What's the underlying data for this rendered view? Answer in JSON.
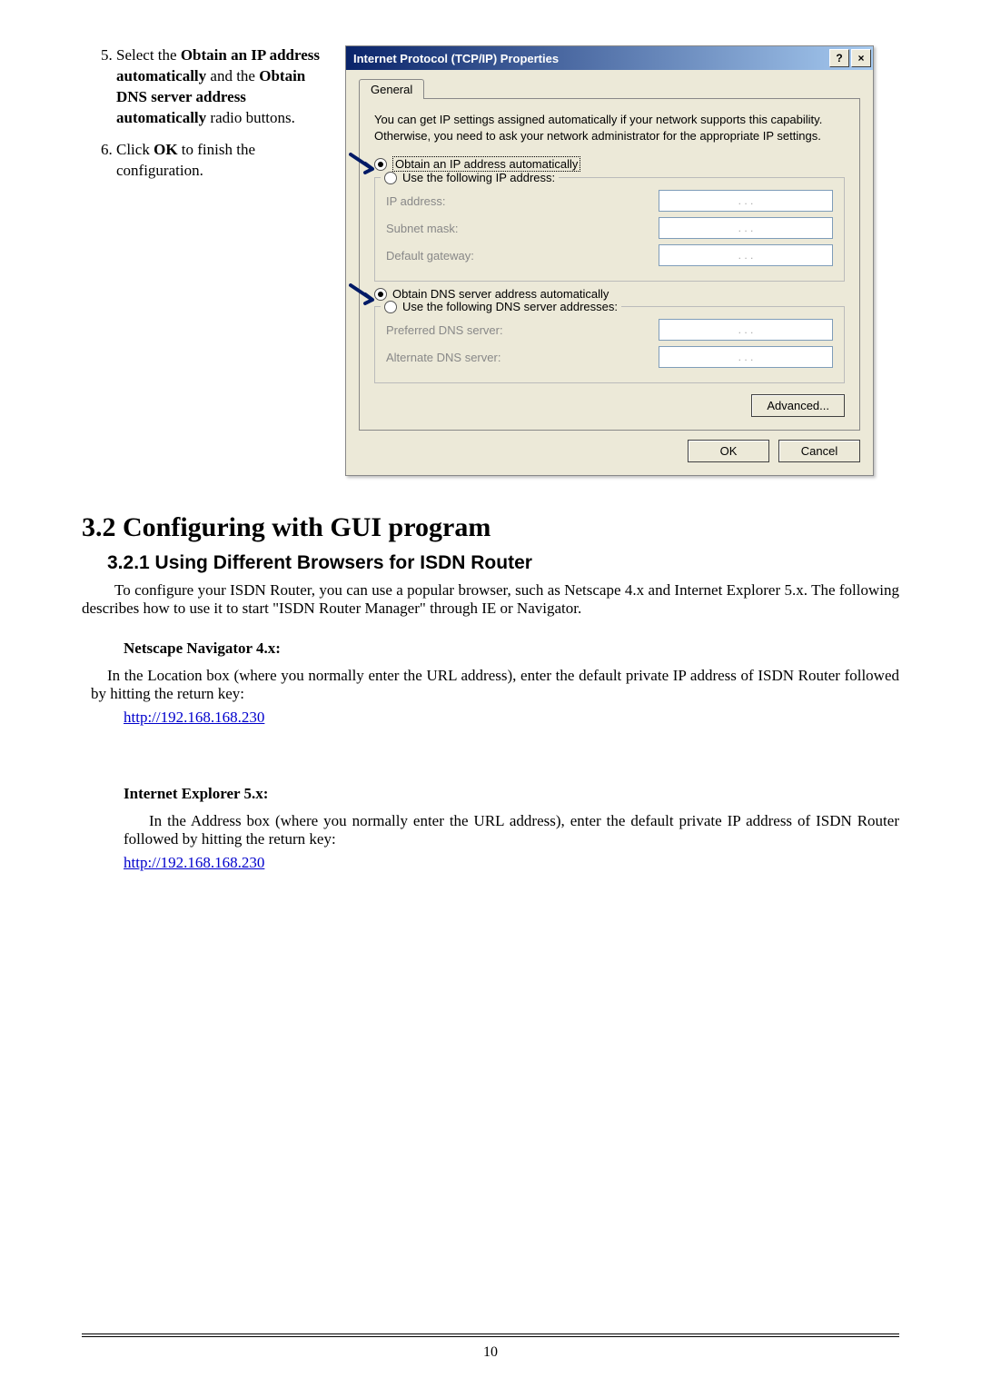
{
  "instructions": {
    "step5": {
      "prefix": "Select the ",
      "b1": "Obtain an IP address automatically",
      "mid": " and the ",
      "b2": "Obtain DNS server address automatically",
      "suffix": " radio buttons."
    },
    "step6": {
      "prefix": "Click ",
      "b1": "OK",
      "suffix": " to finish the configuration."
    }
  },
  "dialog": {
    "title": "Internet Protocol (TCP/IP) Properties",
    "help_icon": "?",
    "close_icon": "×",
    "tab_general": "General",
    "description": "You can get IP settings assigned automatically if your network supports this capability. Otherwise, you need to ask your network administrator for the appropriate IP settings.",
    "radio_obtain_ip": "Obtain an IP address automatically",
    "radio_use_ip": "Use the following IP address:",
    "label_ip": "IP address:",
    "label_subnet": "Subnet mask:",
    "label_gateway": "Default gateway:",
    "radio_obtain_dns": "Obtain DNS server address automatically",
    "radio_use_dns": "Use the following DNS server addresses:",
    "label_pref_dns": "Preferred DNS server:",
    "label_alt_dns": "Alternate DNS server:",
    "ip_dots": ".      .      .",
    "btn_advanced": "Advanced...",
    "btn_ok": "OK",
    "btn_cancel": "Cancel"
  },
  "section": {
    "title": "3.2 Configuring with GUI program",
    "subsection": "3.2.1 Using Different Browsers for ISDN Router",
    "intro": "To configure your ISDN Router, you can use a popular browser, such as Netscape 4.x and Internet Explorer 5.x.  The following describes how to use it to start \"ISDN Router Manager\" through IE or Navigator.",
    "netscape_label": "Netscape Navigator 4.x:",
    "netscape_text": "In the Location box (where you normally enter the URL address), enter the default private IP address of ISDN Router followed by hitting the return key:",
    "url": "http://192.168.168.230",
    "ie_label": "Internet Explorer 5.x:",
    "ie_text": "In the Address box (where you normally enter the URL address), enter the default private IP address of ISDN Router followed by hitting the return key:"
  },
  "page_number": "10"
}
